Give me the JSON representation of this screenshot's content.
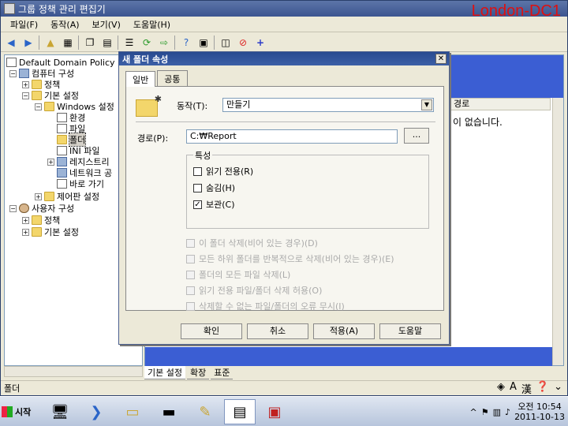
{
  "window": {
    "title": "그룹 정책 관리 편집기",
    "host_label": "London-DC1",
    "min": "_",
    "max": "□",
    "close": "✕"
  },
  "menu": [
    "파일(F)",
    "동작(A)",
    "보기(V)",
    "도움말(H)"
  ],
  "toolbar_icons": [
    "back-arrow-icon",
    "forward-arrow-icon",
    "up-folder-icon",
    "console-tree-icon",
    "copy-icon",
    "paste-icon",
    "list-view-icon",
    "refresh-icon",
    "export-icon",
    "help-icon",
    "properties-icon",
    "new-item-icon",
    "delete-icon",
    "add-icon"
  ],
  "tree": {
    "policy": "Default Domain Policy [I",
    "computer_config": "컴퓨터 구성",
    "policies": "정책",
    "prefs": "기본 설정",
    "windows_settings": "Windows 설정",
    "environment": "환경",
    "files": "파일",
    "folders": "폴더",
    "ini_files": "INI 파일",
    "registry": "레지스트리",
    "network_shares": "네트워크 공",
    "shortcuts": "바로 가기",
    "control_panel": "제어판 설정",
    "user_config": "사용자 구성",
    "user_policies": "정책",
    "user_prefs": "기본 설정"
  },
  "right_pane": {
    "column_header": "경로",
    "empty_message": "이 없습니다."
  },
  "bottom_tabs": [
    "기본 설정",
    "확장",
    "표준"
  ],
  "status": {
    "text": "폴더",
    "tray_icons": [
      "language-icon",
      "korean-a-label",
      "hanja-label",
      "help-icon",
      "options-icon"
    ],
    "lang_a": "A",
    "lang_han": "漢"
  },
  "dialog": {
    "title": "새 폴더 속성",
    "close": "✕",
    "tabs": [
      "일반",
      "공통"
    ],
    "action_label": "동작(T):",
    "action_value": "만들기",
    "path_label": "경로(P):",
    "path_value": "C:₩Report",
    "browse": "...",
    "attributes_title": "특성",
    "attributes": [
      {
        "label": "읽기 전용(R)",
        "checked": false
      },
      {
        "label": "숨김(H)",
        "checked": false
      },
      {
        "label": "보관(C)",
        "checked": true
      }
    ],
    "options": [
      "이 폴더 삭제(비어 있는 경우)(D)",
      "모든 하위 폴더를 반복적으로 삭제(비어 있는 경우)(E)",
      "폴더의 모든 파일 삭제(L)",
      "읽기 전용 파일/폴더 삭제 허용(O)",
      "삭제할 수 없는 파일/폴더의 오류 무시(I)"
    ],
    "buttons": {
      "ok": "확인",
      "cancel": "취소",
      "apply": "적용(A)",
      "help": "도움말"
    }
  },
  "taskbar": {
    "start": "시작",
    "clock_time": "오전 10:54",
    "clock_date": "2011-10-13",
    "tasks": [
      "server-manager-icon",
      "powershell-icon",
      "explorer-icon",
      "cmd-icon",
      "notepad-icon",
      "gpmc-icon",
      "toolbox-icon"
    ]
  }
}
